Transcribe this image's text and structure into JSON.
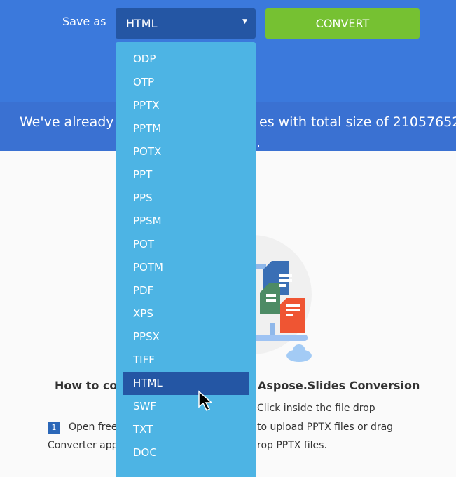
{
  "toolbar": {
    "save_as_label": "Save as",
    "selected_format": "HTML",
    "convert_label": "CONVERT"
  },
  "stats": {
    "text_left": "We've already p",
    "text_right": "es with total size of 21057652",
    "text_line2": "."
  },
  "dropdown": {
    "options": [
      "ODP",
      "OTP",
      "PPTX",
      "PPTM",
      "POTX",
      "PPT",
      "PPS",
      "PPSM",
      "POT",
      "POTM",
      "PDF",
      "XPS",
      "PPSX",
      "TIFF",
      "HTML",
      "SWF",
      "TXT",
      "DOC"
    ],
    "highlighted": "HTML"
  },
  "howto": {
    "title_left": "How to co",
    "title_right": "Aspose.Slides Conversion",
    "step_number": "1",
    "line1_left": "Open free",
    "line1_right": "Click inside the file drop",
    "line2_right": "to upload PPTX files or drag",
    "line3_left": "Converter app",
    "line3_right": "rop PPTX files."
  },
  "colors": {
    "header": "#3b79dc",
    "select": "#2456a4",
    "convert": "#76c132",
    "menu": "#4db4e4"
  }
}
